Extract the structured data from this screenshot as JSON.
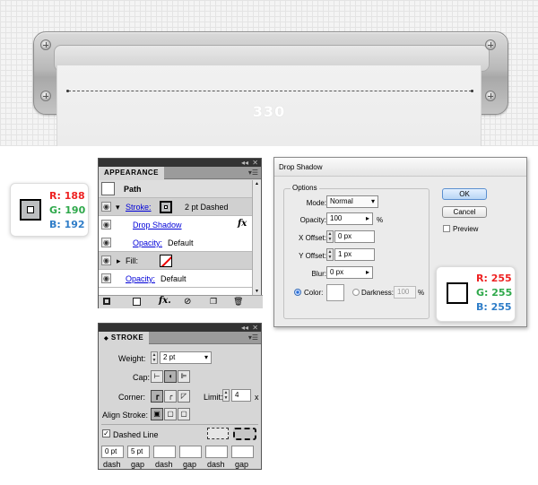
{
  "canvas": {
    "label": "330"
  },
  "chip_left": {
    "r": "R: 188",
    "g": "G: 190",
    "b": "B: 192",
    "swatch_color": "#bcbec0"
  },
  "chip_right": {
    "r": "R: 255",
    "g": "G: 255",
    "b": "B: 255",
    "swatch_color": "#ffffff"
  },
  "colors": {
    "red": "#ee2222",
    "green": "#2ea84a",
    "blue": "#2f7dc8"
  },
  "appearance": {
    "tab": "APPEARANCE",
    "header": "Path",
    "stroke_label": "Stroke:",
    "stroke_value": "2 pt Dashed",
    "drop_shadow": "Drop Shadow",
    "fx": "fx",
    "opacity_label": "Opacity:",
    "opacity_value": "Default",
    "fill_label": "Fill:",
    "opacity2_label": "Opacity:",
    "opacity2_value": "Default",
    "footer_fx": "fx."
  },
  "stroke": {
    "tab": "STROKE",
    "weight_label": "Weight:",
    "weight_value": "2 pt",
    "cap_label": "Cap:",
    "corner_label": "Corner:",
    "limit_label": "Limit:",
    "limit_value": "4",
    "limit_unit": "x",
    "align_label": "Align Stroke:",
    "dashed_label": "Dashed Line",
    "dash_values": [
      "0 pt",
      "5 pt",
      "",
      "",
      "",
      ""
    ],
    "dash_labels": [
      "dash",
      "gap",
      "dash",
      "gap",
      "dash",
      "gap"
    ]
  },
  "dialog": {
    "title": "Drop Shadow",
    "group": "Options",
    "mode_label": "Mode:",
    "mode_value": "Normal",
    "opacity_label": "Opacity:",
    "opacity_value": "100",
    "opacity_unit": "%",
    "xoffset_label": "X Offset:",
    "xoffset_value": "0 px",
    "yoffset_label": "Y Offset:",
    "yoffset_value": "1 px",
    "blur_label": "Blur:",
    "blur_value": "0 px",
    "color_label": "Color:",
    "darkness_label": "Darkness:",
    "darkness_value": "100",
    "darkness_unit": "%",
    "ok": "OK",
    "cancel": "Cancel",
    "preview": "Preview"
  }
}
